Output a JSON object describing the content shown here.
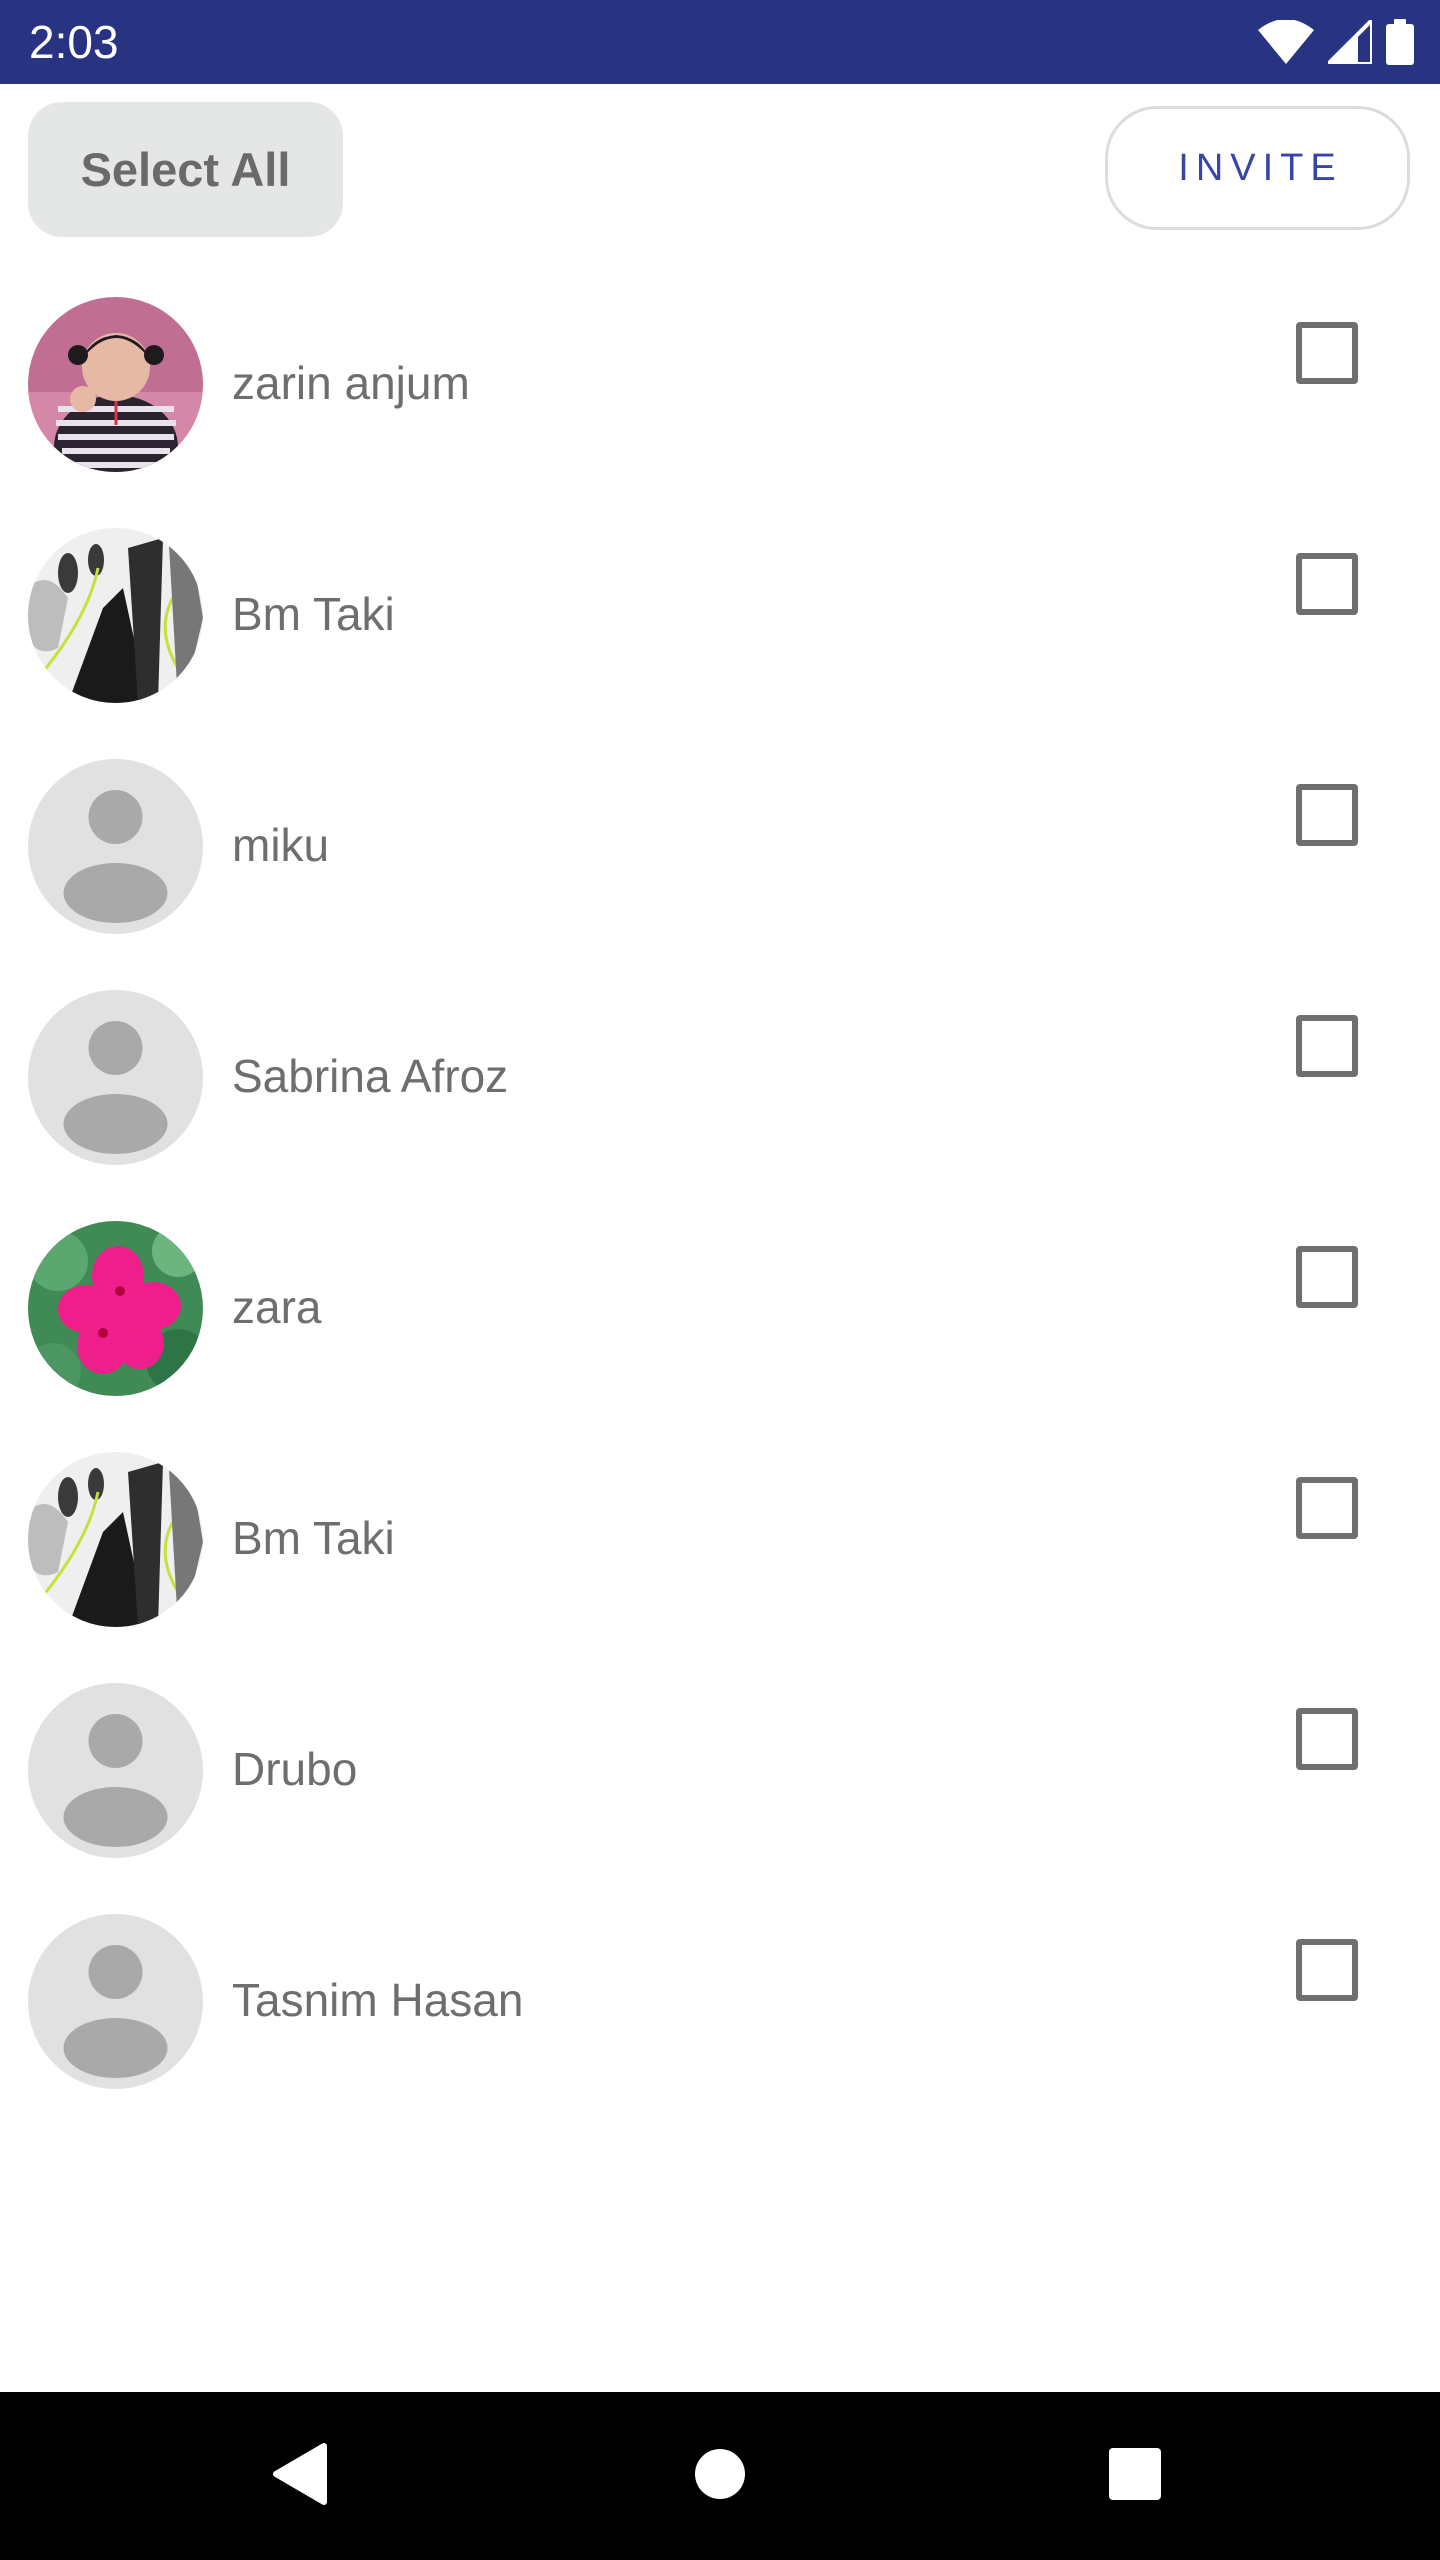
{
  "status_bar": {
    "time": "2:03",
    "icons": [
      "wifi-icon",
      "cell-signal-icon",
      "battery-icon"
    ],
    "background_color": "#283481"
  },
  "actions": {
    "select_all_label": "Select All",
    "invite_label": "INVITE",
    "invite_color": "#3645a6"
  },
  "contacts": [
    {
      "name": "zarin anjum",
      "avatar": "photo-child",
      "checked": false
    },
    {
      "name": "Bm Taki",
      "avatar": "photo-art",
      "checked": false
    },
    {
      "name": "miku",
      "avatar": "default-person-icon",
      "checked": false
    },
    {
      "name": "Sabrina Afroz",
      "avatar": "default-person-icon",
      "checked": false
    },
    {
      "name": "zara",
      "avatar": "photo-flower",
      "checked": false
    },
    {
      "name": "Bm Taki",
      "avatar": "photo-art",
      "checked": false
    },
    {
      "name": "Drubo",
      "avatar": "default-person-icon",
      "checked": false
    },
    {
      "name": "Tasnim Hasan",
      "avatar": "default-person-icon",
      "checked": false
    }
  ],
  "nav_bar": {
    "buttons": [
      "back-icon",
      "home-icon",
      "recents-icon"
    ]
  }
}
